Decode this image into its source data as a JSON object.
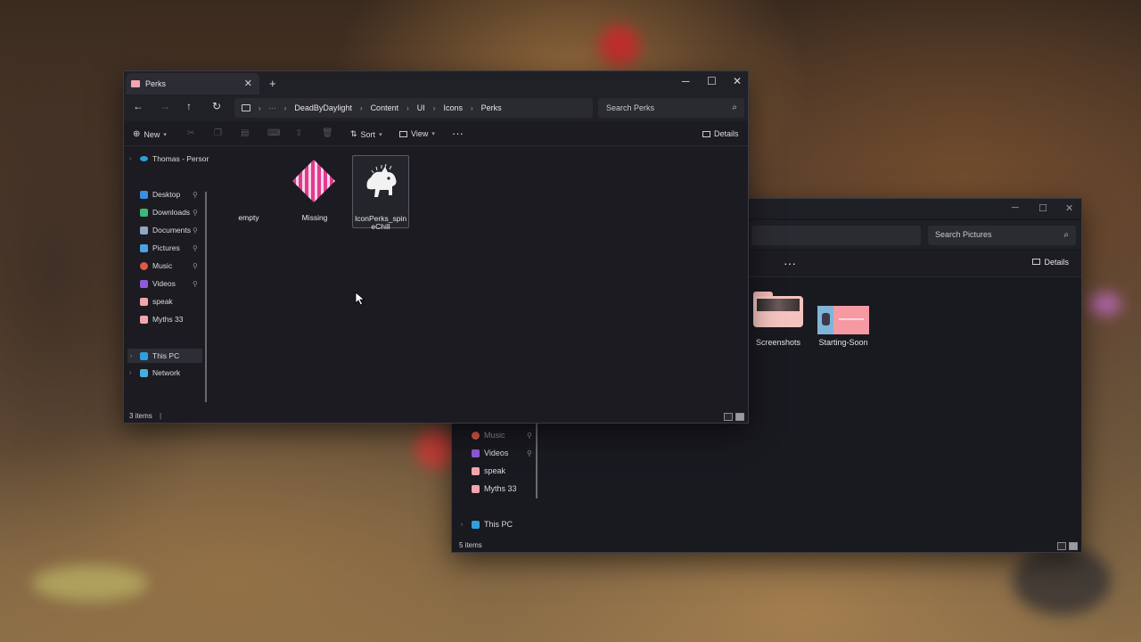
{
  "back_window": {
    "search_placeholder": "Search Pictures",
    "details_label": "Details",
    "folders": [
      {
        "name": "Screenshots"
      },
      {
        "name": "Starting-Soon"
      }
    ],
    "nav_items": [
      {
        "label": "Music",
        "icon": "music-icon"
      },
      {
        "label": "Videos",
        "icon": "videos-icon"
      },
      {
        "label": "speak",
        "icon": "folder-icon"
      },
      {
        "label": "Myths 33",
        "icon": "folder-icon"
      },
      {
        "label": "This PC",
        "icon": "pc-icon"
      }
    ],
    "status": "5 items"
  },
  "front_window": {
    "tab_title": "Perks",
    "breadcrumbs": [
      "DeadByDaylight",
      "Content",
      "UI",
      "Icons",
      "Perks"
    ],
    "search_placeholder": "Search Perks",
    "cmd": {
      "new_label": "New",
      "sort_label": "Sort",
      "view_label": "View",
      "details_label": "Details"
    },
    "nav": {
      "account": "Thomas - Persor",
      "quick_access": [
        {
          "label": "Desktop",
          "icon": "desktop-icon",
          "color": "#3b8ee0"
        },
        {
          "label": "Downloads",
          "icon": "downloads-icon",
          "color": "#3bb87a"
        },
        {
          "label": "Documents",
          "icon": "documents-icon",
          "color": "#8fa6c9"
        },
        {
          "label": "Pictures",
          "icon": "pictures-icon",
          "color": "#4aa3e0"
        },
        {
          "label": "Music",
          "icon": "music-icon",
          "color": "#e0584a"
        },
        {
          "label": "Videos",
          "icon": "videos-icon",
          "color": "#8e5ad8"
        },
        {
          "label": "speak",
          "icon": "folder-icon",
          "color": "#f4a6ad"
        },
        {
          "label": "Myths 33",
          "icon": "folder-icon",
          "color": "#f4a6ad"
        }
      ],
      "this_pc": "This PC",
      "network": "Network"
    },
    "files": [
      {
        "name": "empty"
      },
      {
        "name": "Missing"
      },
      {
        "name": "IconPerks_spineChill"
      }
    ],
    "status": "3 items"
  }
}
